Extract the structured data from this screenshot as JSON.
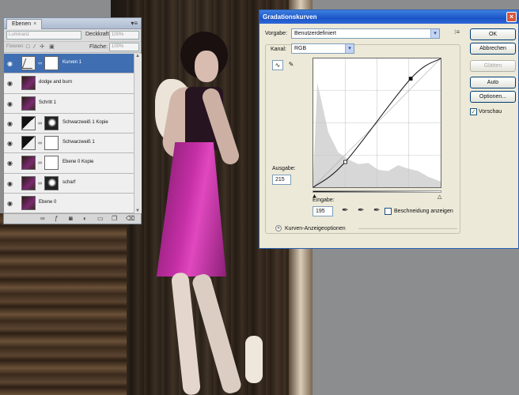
{
  "layers_panel": {
    "tab_label": "Ebenen",
    "tab_close": "×",
    "menu_icon": "panel-menu-icon",
    "blend_mode": "Luminanz",
    "opacity_label": "Deckkraft:",
    "opacity_value": "100%",
    "lock_label": "Fixieren:",
    "lock_icons": "□ ⁄ ✢ ▣",
    "fill_label": "Fläche:",
    "fill_value": "100%",
    "layers": [
      {
        "name": "Kurven 1",
        "selected": true
      },
      {
        "name": "dodge and burn"
      },
      {
        "name": "Schritt 1"
      },
      {
        "name": "Schwarzweiß 1 Kopie"
      },
      {
        "name": "Schwarzweiß 1"
      },
      {
        "name": "Ebene 0 Kopie"
      },
      {
        "name": "scharf"
      },
      {
        "name": "Ebene 0"
      }
    ],
    "footer_icons": [
      "link-icon",
      "fx-icon",
      "mask-icon",
      "adjustment-icon",
      "folder-icon",
      "new-layer-icon",
      "trash-icon"
    ]
  },
  "curves_dialog": {
    "title": "Gradationskurven",
    "close": "×",
    "preset_label": "Vorgabe:",
    "preset_value": "Benutzerdefiniert",
    "channel_label": "Kanal:",
    "channel_value": "RGB",
    "output_label": "Ausgabe:",
    "output_value": "215",
    "input_label": "Eingabe:",
    "input_value": "195",
    "clipping_label": "Beschneidung anzeigen",
    "clipping_checked": false,
    "curve_options_label": "Kurven-Anzeigeoptionen",
    "buttons": {
      "ok": "OK",
      "cancel": "Abbrechen",
      "smooth": "Glätten",
      "auto": "Auto",
      "options": "Optionen...",
      "preview": "Vorschau"
    },
    "preview_checked": true,
    "curve_points": [
      [
        0,
        0
      ],
      [
        64,
        50
      ],
      [
        195,
        215
      ],
      [
        255,
        255
      ]
    ],
    "histogram": [
      [
        0,
        20
      ],
      [
        8,
        180
      ],
      [
        16,
        150
      ],
      [
        30,
        95
      ],
      [
        50,
        60
      ],
      [
        70,
        48
      ],
      [
        90,
        40
      ],
      [
        110,
        42
      ],
      [
        130,
        30
      ],
      [
        150,
        28
      ],
      [
        170,
        38
      ],
      [
        190,
        32
      ],
      [
        210,
        28
      ],
      [
        230,
        18
      ],
      [
        255,
        10
      ]
    ]
  }
}
